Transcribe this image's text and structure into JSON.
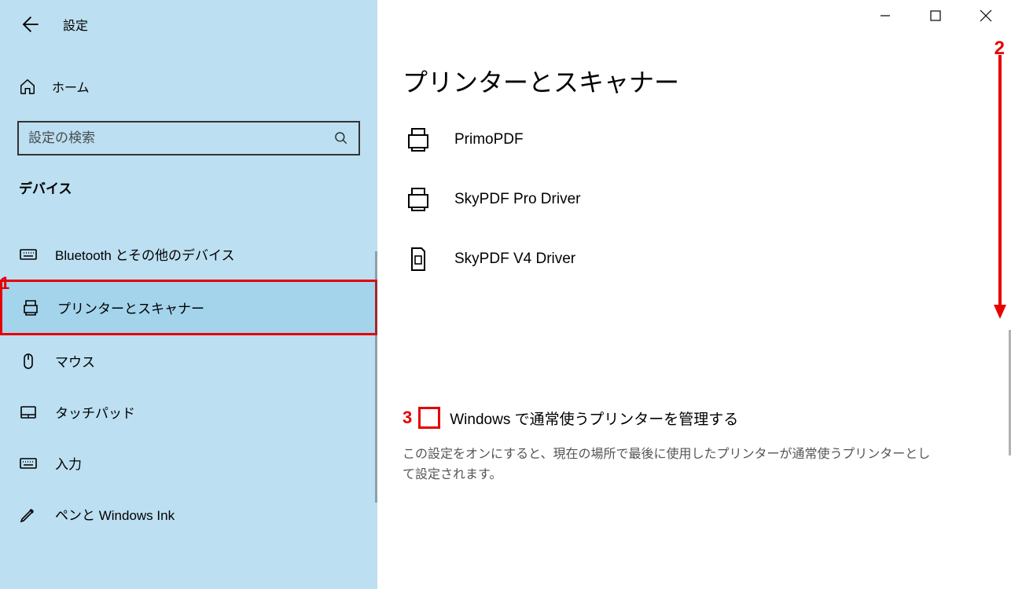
{
  "window": {
    "title": "設定"
  },
  "sidebar": {
    "home_label": "ホーム",
    "search_placeholder": "設定の検索",
    "section_label": "デバイス",
    "items": [
      {
        "icon": "bluetooth",
        "label": "Bluetooth とその他のデバイス"
      },
      {
        "icon": "printer",
        "label": "プリンターとスキャナー"
      },
      {
        "icon": "mouse",
        "label": "マウス"
      },
      {
        "icon": "touchpad",
        "label": "タッチパッド"
      },
      {
        "icon": "keyboard",
        "label": "入力"
      },
      {
        "icon": "pen",
        "label": "ペンと Windows Ink"
      }
    ]
  },
  "main": {
    "page_title": "プリンターとスキャナー",
    "printers": [
      {
        "name": "PrimoPDF",
        "icon": "printer"
      },
      {
        "name": "SkyPDF Pro Driver",
        "icon": "printer"
      },
      {
        "name": "SkyPDF V4 Driver",
        "icon": "printer-doc"
      }
    ],
    "default_printer": {
      "checkbox_label": "Windows で通常使うプリンターを管理する",
      "help": "この設定をオンにすると、現在の場所で最後に使用したプリンターが通常使うプリンターとして設定されます。",
      "checked": false
    }
  },
  "annotations": {
    "n1": "1",
    "n2": "2",
    "n3": "3",
    "highlight_color": "#e60000"
  }
}
